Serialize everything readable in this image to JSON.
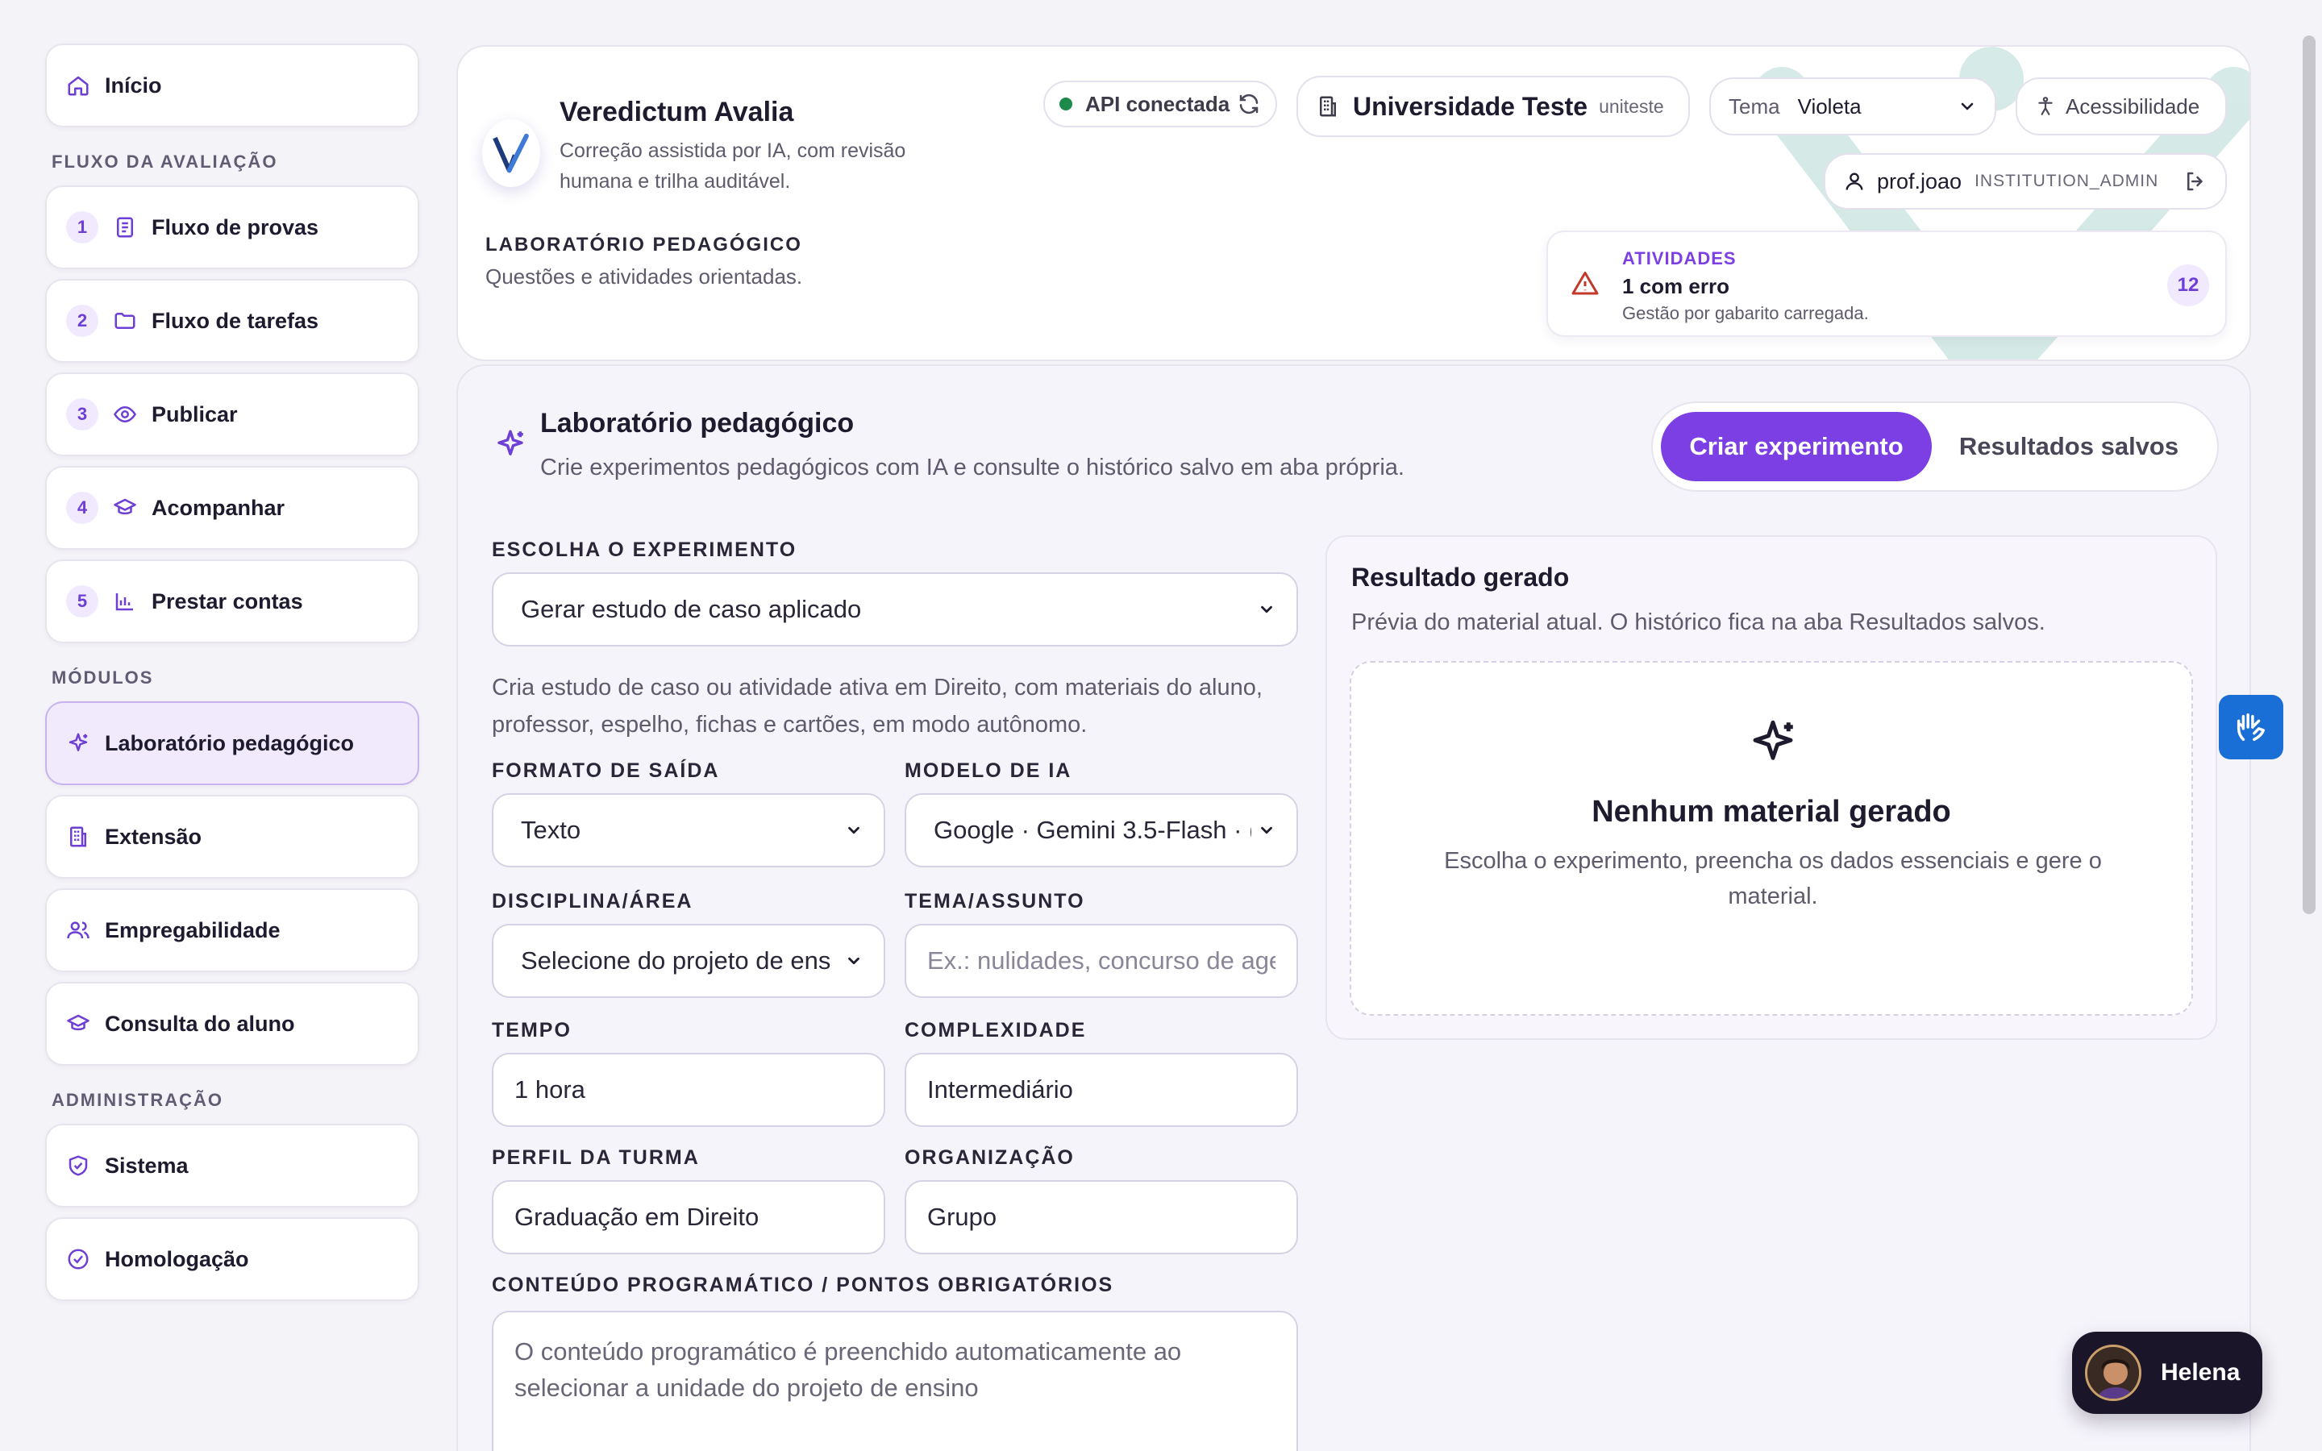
{
  "sidebar": {
    "home": "Início",
    "flow_section": "FLUXO DA AVALIAÇÃO",
    "flow": [
      {
        "num": "1",
        "label": "Fluxo de provas"
      },
      {
        "num": "2",
        "label": "Fluxo de tarefas"
      },
      {
        "num": "3",
        "label": "Publicar"
      },
      {
        "num": "4",
        "label": "Acompanhar"
      },
      {
        "num": "5",
        "label": "Prestar contas"
      }
    ],
    "modules_section": "MÓDULOS",
    "modules": [
      {
        "label": "Laboratório pedagógico",
        "icon": "sparkle-icon",
        "active": true
      },
      {
        "label": "Extensão",
        "icon": "building-icon"
      },
      {
        "label": "Empregabilidade",
        "icon": "users-icon"
      },
      {
        "label": "Consulta do aluno",
        "icon": "graduation-cap-icon"
      }
    ],
    "admin_section": "ADMINISTRAÇÃO",
    "admin": [
      {
        "label": "Sistema",
        "icon": "shield-check-icon"
      },
      {
        "label": "Homologação",
        "icon": "check-circle-icon"
      }
    ]
  },
  "header": {
    "app_title": "Veredictum Avalia",
    "app_subtitle": "Correção assistida por IA, com revisão humana e trilha auditável.",
    "page_eyebrow": "LABORATÓRIO PEDAGÓGICO",
    "page_desc": "Questões e atividades orientadas.",
    "api_status": "API conectada",
    "institution_name": "Universidade Teste",
    "institution_code": "uniteste",
    "theme_label": "Tema",
    "theme_value": "Violeta",
    "accessibility": "Acessibilidade",
    "user_name": "prof.joao",
    "user_role": "INSTITUTION_ADMIN",
    "activities": {
      "eyebrow": "ATIVIDADES",
      "status": "1 com erro",
      "detail": "Gestão por gabarito carregada.",
      "count": "12"
    }
  },
  "main": {
    "title": "Laboratório pedagógico",
    "subtitle": "Crie experimentos pedagógicos com IA e consulte o histórico salvo em aba própria.",
    "tab_create": "Criar experimento",
    "tab_saved": "Resultados salvos",
    "form": {
      "experiment_label": "ESCOLHA O EXPERIMENTO",
      "experiment_value": "Gerar estudo de caso aplicado",
      "experiment_desc": "Cria estudo de caso ou atividade ativa em Direito, com materiais do aluno, professor, espelho, fichas e cartões, em modo autônomo.",
      "format_label": "FORMATO DE SAÍDA",
      "format_value": "Texto",
      "model_label": "MODELO DE IA",
      "model_value": "Google · Gemini 3.5-Flash · (",
      "discipline_label": "DISCIPLINA/ÁREA",
      "discipline_value": "Selecione do projeto de ens",
      "topic_label": "TEMA/ASSUNTO",
      "topic_placeholder": "Ex.: nulidades, concurso de age",
      "time_label": "TEMPO",
      "time_value": "1 hora",
      "complexity_label": "COMPLEXIDADE",
      "complexity_value": "Intermediário",
      "profile_label": "PERFIL DA TURMA",
      "profile_value": "Graduação em Direito",
      "organization_label": "ORGANIZAÇÃO",
      "organization_value": "Grupo",
      "content_label": "CONTEÚDO PROGRAMÁTICO / PONTOS OBRIGATÓRIOS",
      "content_placeholder": "O conteúdo programático é preenchido automaticamente ao selecionar a unidade do projeto de ensino"
    },
    "result": {
      "title": "Resultado gerado",
      "subtitle": "Prévia do material atual. O histórico fica na aba Resultados salvos.",
      "empty_title": "Nenhum material gerado",
      "empty_desc": "Escolha o experimento, preencha os dados essenciais e gere o material."
    }
  },
  "assistant": {
    "name": "Helena"
  },
  "colors": {
    "accent": "#7b3fe4",
    "accent_soft": "#f1eaff",
    "success": "#1b8a4a",
    "warning": "#c0392b",
    "vlibras": "#1a6fd6"
  }
}
